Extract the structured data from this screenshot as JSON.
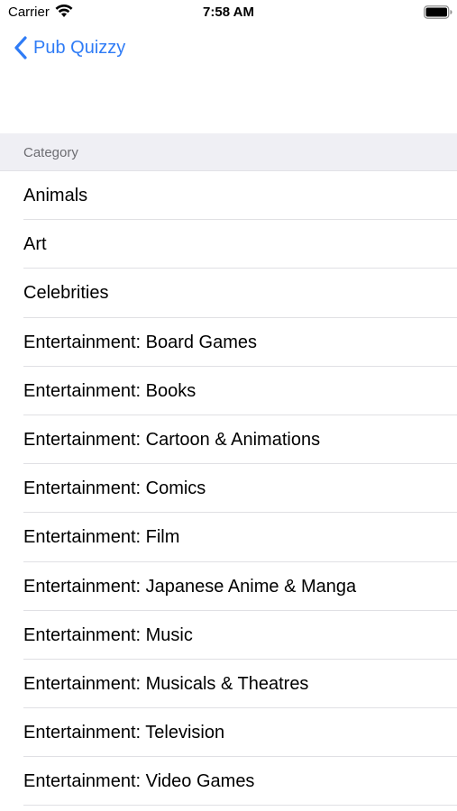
{
  "status_bar": {
    "carrier": "Carrier",
    "time": "7:58 AM",
    "icons": [
      "wifi-icon",
      "battery-icon"
    ]
  },
  "nav_bar": {
    "back_label": "Pub Quizzy",
    "back_icon": "chevron-left-icon",
    "accent_color": "#2f7cf6"
  },
  "section": {
    "header": "Category"
  },
  "categories": [
    "Animals",
    "Art",
    "Celebrities",
    "Entertainment: Board Games",
    "Entertainment: Books",
    "Entertainment: Cartoon & Animations",
    "Entertainment: Comics",
    "Entertainment: Film",
    "Entertainment: Japanese Anime & Manga",
    "Entertainment: Music",
    "Entertainment: Musicals & Theatres",
    "Entertainment: Television",
    "Entertainment: Video Games"
  ]
}
